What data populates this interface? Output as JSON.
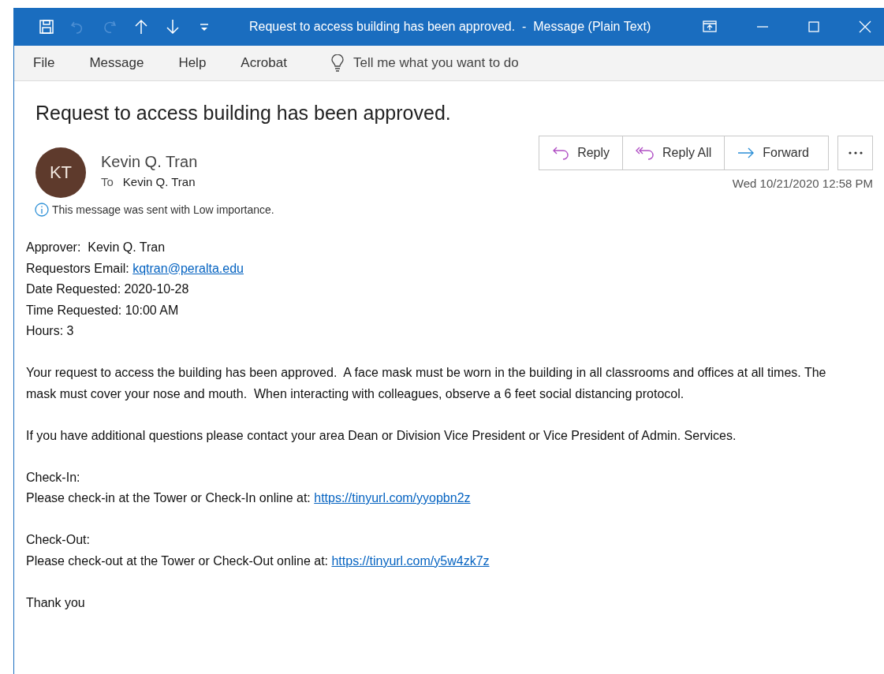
{
  "window": {
    "title": "Request to access building has been approved.  -  Message (Plain Text)"
  },
  "quick_access": [
    {
      "kind": "save",
      "disabled": false
    },
    {
      "kind": "undo",
      "disabled": true
    },
    {
      "kind": "redo",
      "disabled": true
    },
    {
      "kind": "up",
      "disabled": false
    },
    {
      "kind": "down",
      "disabled": false
    },
    {
      "kind": "customize",
      "disabled": false
    }
  ],
  "menu": [
    "File",
    "Message",
    "Help",
    "Acrobat"
  ],
  "tell_me": {
    "placeholder": "Tell me what you want to do"
  },
  "message": {
    "subject": "Request to access building has been approved.",
    "avatar": "KT",
    "sender": "Kevin Q. Tran",
    "to_label": "To",
    "to": "Kevin Q. Tran",
    "importance_note": "This message was sent with Low importance.",
    "date": "Wed 10/21/2020 12:58 PM"
  },
  "actions": [
    {
      "kind": "reply",
      "label": "Reply"
    },
    {
      "kind": "reply_all",
      "label": "Reply All"
    },
    {
      "kind": "forward",
      "label": "Forward"
    }
  ],
  "body": [
    [
      {
        "text": "Approver:  Kevin Q. Tran"
      },
      {
        "text": "Requestors Email: ",
        "link": "kqtran@peralta.edu"
      },
      {
        "text": "Date Requested: 2020-10-28"
      },
      {
        "text": "Time Requested: 10:00 AM"
      },
      {
        "text": "Hours: 3"
      }
    ],
    [
      {
        "text": "Your request to access the building has been approved.  A face mask must be worn in the building in all classrooms and offices at all times. The mask must cover your nose and mouth.  When interacting with colleagues, observe a 6 feet social distancing protocol."
      }
    ],
    [
      {
        "text": "If you have additional questions please contact your area Dean or Division Vice President or Vice President of Admin. Services."
      }
    ],
    [
      {
        "text": "Check-In:"
      },
      {
        "text": "Please check-in at the Tower or Check-In online at: ",
        "link": "https://tinyurl.com/yyopbn2z"
      }
    ],
    [
      {
        "text": "Check-Out:"
      },
      {
        "text": "Please check-out at the Tower or Check-Out online at: ",
        "link": "https://tinyurl.com/y5w4zk7z"
      }
    ],
    [
      {
        "text": "Thank you"
      }
    ]
  ]
}
